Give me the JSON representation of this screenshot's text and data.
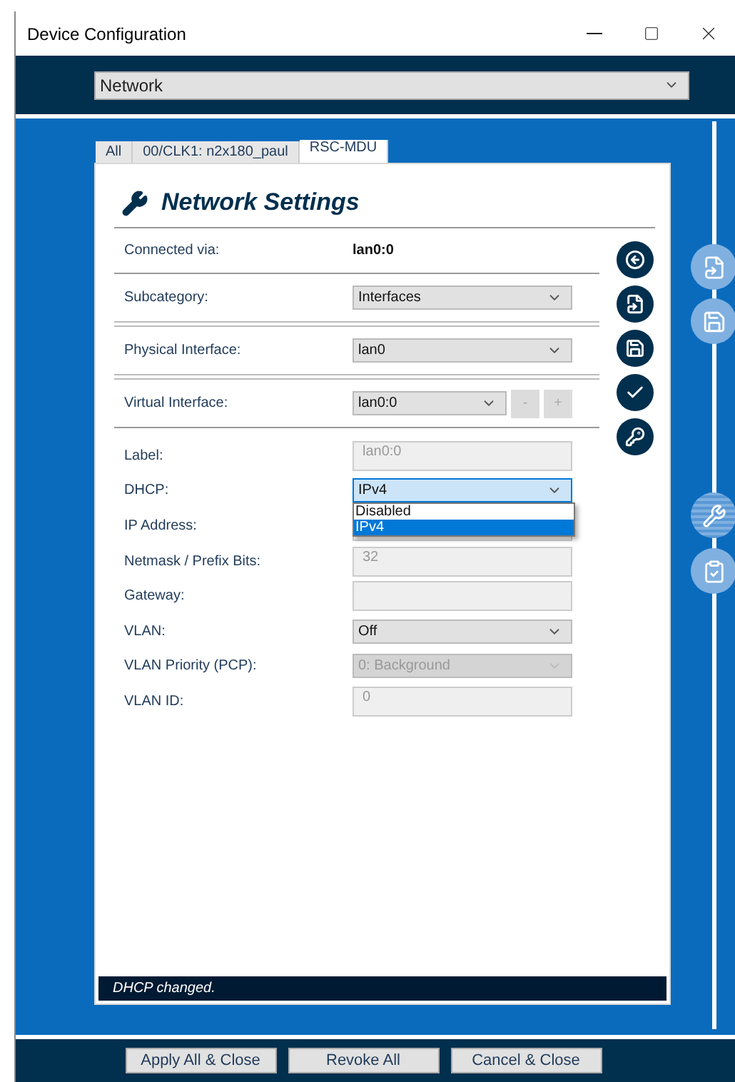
{
  "window": {
    "title": "Device Configuration"
  },
  "category_select": {
    "value": "Network"
  },
  "tabs": [
    {
      "label": "All",
      "selected": false
    },
    {
      "label": "00/CLK1: n2x180_paul",
      "selected": false
    },
    {
      "label": "RSC-MDU",
      "selected": true
    }
  ],
  "panel": {
    "title": "Network Settings"
  },
  "rows": [
    {
      "label": "Connected via:",
      "kind": "text",
      "value": "lan0:0",
      "double_rule": false
    },
    {
      "label": "Subcategory:",
      "kind": "select",
      "value": "Interfaces",
      "double_rule": true
    },
    {
      "label": "Physical Interface:",
      "kind": "select",
      "value": "lan0",
      "double_rule": true
    },
    {
      "label": "Virtual Interface:",
      "kind": "select_buttons",
      "value": "lan0:0",
      "buttons": [
        {
          "label": "-",
          "disabled": true
        },
        {
          "label": "+",
          "disabled": true
        }
      ],
      "double_rule": false
    }
  ],
  "fields": [
    {
      "label": "Label:",
      "kind": "input",
      "value": "lan0:0",
      "disabled": true
    },
    {
      "label": "DHCP:",
      "kind": "select",
      "value": "IPv4",
      "disabled": false,
      "open": true,
      "options": [
        {
          "label": "Disabled",
          "selected": false
        },
        {
          "label": "IPv4",
          "selected": true
        }
      ]
    },
    {
      "label": "IP Address:",
      "kind": "input",
      "disabled": true
    },
    {
      "label": "Netmask / Prefix Bits:",
      "kind": "input",
      "value": "32",
      "disabled": true
    },
    {
      "label": "Gateway:",
      "kind": "input",
      "disabled": true
    },
    {
      "label": "VLAN:",
      "kind": "select",
      "value": "Off",
      "disabled": false,
      "open": false
    },
    {
      "label": "VLAN Priority (PCP):",
      "kind": "select",
      "value": "0: Background",
      "disabled": true,
      "open": false
    },
    {
      "label": "VLAN ID:",
      "kind": "input",
      "value": "0",
      "disabled": true
    }
  ],
  "status_bar": {
    "text": "DHCP changed."
  },
  "buttons": [
    {
      "label": "Apply All & Close"
    },
    {
      "label": "Revoke All"
    },
    {
      "label": "Cancel & Close"
    }
  ]
}
